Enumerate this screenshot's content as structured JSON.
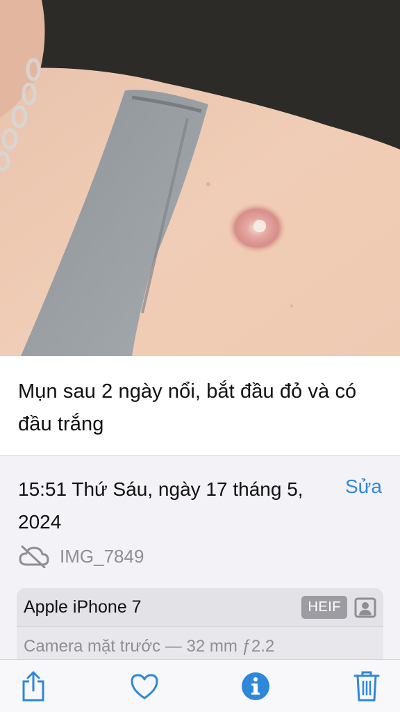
{
  "caption": "Mụn sau 2 ngày nổi, bắt đầu đỏ và có đầu trắng",
  "info": {
    "datetime": "15:51 Thứ Sáu, ngày 17 tháng 5, 2024",
    "edit_label": "Sửa",
    "filename": "IMG_7849",
    "cloud_icon": "cloud-slash-icon"
  },
  "device": {
    "name": "Apple iPhone 7",
    "format_badge": "HEIF",
    "camera": "Camera mặt trước — 32 mm ƒ2.2"
  },
  "toolbar": {
    "icons": [
      "share-icon",
      "heart-icon",
      "info-icon",
      "trash-icon"
    ]
  },
  "colors": {
    "accent": "#2f87d9",
    "secondary_text": "#8e8e93",
    "background": "#f2f2f7"
  }
}
